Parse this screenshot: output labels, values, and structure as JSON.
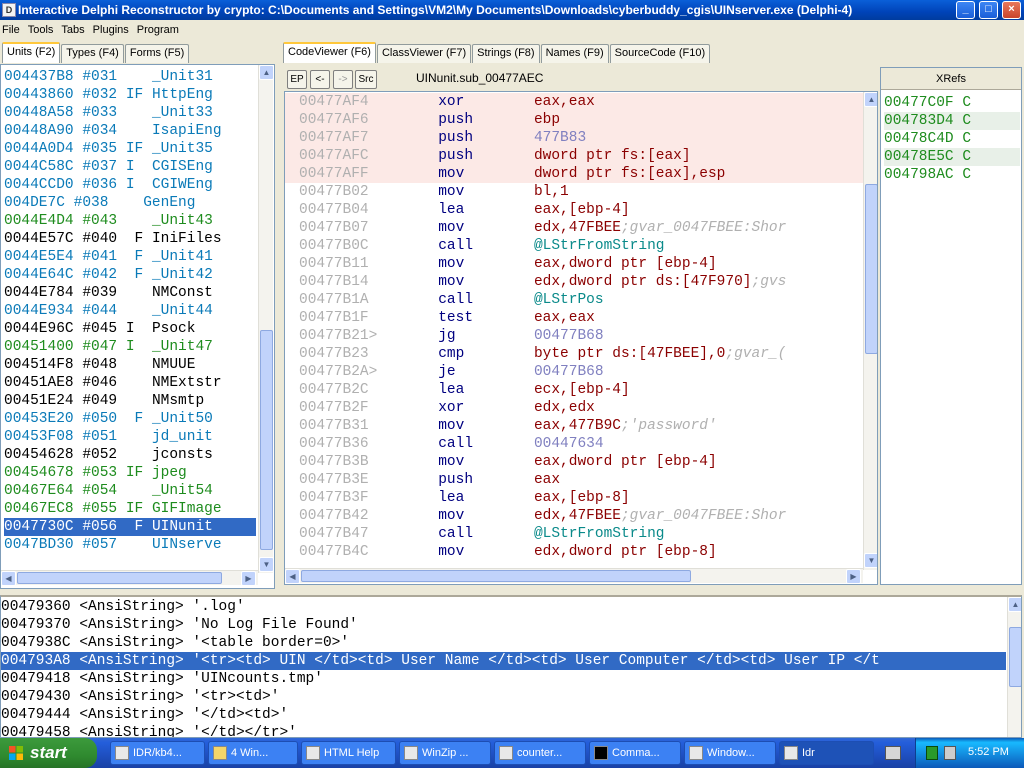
{
  "window": {
    "title": "Interactive Delphi Reconstructor by crypto: C:\\Documents and Settings\\VM2\\My Documents\\Downloads\\cyberbuddy_cgis\\UINserver.exe (Delphi-4)",
    "minimize": "_",
    "maximize": "□",
    "close": "×"
  },
  "menu": [
    "File",
    "Tools",
    "Tabs",
    "Plugins",
    "Program"
  ],
  "left_tabs": [
    "Units (F2)",
    "Types (F4)",
    "Forms (F5)"
  ],
  "units": [
    {
      "addr": "004437B8",
      "num": "#031",
      "flags": "  ",
      "name": "_Unit31",
      "color": "#0a7ab8"
    },
    {
      "addr": "00443860",
      "num": "#032",
      "flags": "IF",
      "name": "HttpEng",
      "color": "#0a7ab8"
    },
    {
      "addr": "00448A58",
      "num": "#033",
      "flags": "  ",
      "name": "_Unit33",
      "color": "#0a7ab8"
    },
    {
      "addr": "00448A90",
      "num": "#034",
      "flags": "  ",
      "name": "IsapiEng",
      "color": "#0a7ab8"
    },
    {
      "addr": "0044A0D4",
      "num": "#035",
      "flags": "IF",
      "name": "_Unit35",
      "color": "#0a7ab8"
    },
    {
      "addr": "0044C58C",
      "num": "#037",
      "flags": "I ",
      "name": "CGISEng",
      "color": "#0a7ab8"
    },
    {
      "addr": "0044CCD0",
      "num": "#036",
      "flags": "I ",
      "name": "CGIWEng",
      "color": "#0a7ab8"
    },
    {
      "addr": "004DE7C",
      "num": "#038",
      "flags": "  ",
      "name": "GenEng",
      "color": "#0a7ab8"
    },
    {
      "addr": "0044E4D4",
      "num": "#043",
      "flags": "  ",
      "name": "_Unit43",
      "color": "#1e8c1e"
    },
    {
      "addr": "0044E57C",
      "num": "#040",
      "flags": " F",
      "name": "IniFiles",
      "color": "#000000"
    },
    {
      "addr": "0044E5E4",
      "num": "#041",
      "flags": " F",
      "name": "_Unit41",
      "color": "#0a7ab8"
    },
    {
      "addr": "0044E64C",
      "num": "#042",
      "flags": " F",
      "name": "_Unit42",
      "color": "#0a7ab8"
    },
    {
      "addr": "0044E784",
      "num": "#039",
      "flags": "  ",
      "name": "NMConst",
      "color": "#000000"
    },
    {
      "addr": "0044E934",
      "num": "#044",
      "flags": "  ",
      "name": "_Unit44",
      "color": "#0a7ab8"
    },
    {
      "addr": "0044E96C",
      "num": "#045",
      "flags": "I ",
      "name": "Psock",
      "color": "#000000"
    },
    {
      "addr": "00451400",
      "num": "#047",
      "flags": "I ",
      "name": "_Unit47",
      "color": "#1e8c1e"
    },
    {
      "addr": "004514F8",
      "num": "#048",
      "flags": "  ",
      "name": "NMUUE",
      "color": "#000000"
    },
    {
      "addr": "00451AE8",
      "num": "#046",
      "flags": "  ",
      "name": "NMExtstr",
      "color": "#000000"
    },
    {
      "addr": "00451E24",
      "num": "#049",
      "flags": "  ",
      "name": "NMsmtp",
      "color": "#000000"
    },
    {
      "addr": "00453E20",
      "num": "#050",
      "flags": " F",
      "name": "_Unit50",
      "color": "#0a7ab8"
    },
    {
      "addr": "00453F08",
      "num": "#051",
      "flags": "  ",
      "name": "jd_unit",
      "color": "#0a7ab8"
    },
    {
      "addr": "00454628",
      "num": "#052",
      "flags": "  ",
      "name": "jconsts",
      "color": "#000000"
    },
    {
      "addr": "00454678",
      "num": "#053",
      "flags": "IF",
      "name": "jpeg",
      "color": "#1e8c1e"
    },
    {
      "addr": "00467E64",
      "num": "#054",
      "flags": "  ",
      "name": "_Unit54",
      "color": "#1e8c1e"
    },
    {
      "addr": "00467EC8",
      "num": "#055",
      "flags": "IF",
      "name": "GIFImage",
      "color": "#1e8c1e"
    },
    {
      "addr": "0047730C",
      "num": "#056",
      "flags": " F",
      "name": "UINunit",
      "color": "#ffffff",
      "selected": true
    },
    {
      "addr": "0047BD30",
      "num": "#057",
      "flags": "  ",
      "name": "UINserve",
      "color": "#0a7ab8"
    }
  ],
  "code_tabs": [
    "CodeViewer (F6)",
    "ClassViewer (F7)",
    "Strings (F8)",
    "Names (F9)",
    "SourceCode (F10)"
  ],
  "toolbar": {
    "ep": "EP",
    "back": "<-",
    "fwd": "->",
    "src": "Src",
    "proc_name": "UINunit.sub_00477AEC"
  },
  "code": [
    {
      "addr": "00477AF4",
      "mn": "xor",
      "op": "eax,eax",
      "cm": "",
      "hl": true
    },
    {
      "addr": "00477AF6",
      "mn": "push",
      "op": "ebp",
      "cm": "",
      "hl": true
    },
    {
      "addr": "00477AF7",
      "mn": "push",
      "op": "477B83",
      "cm": "",
      "hl": true,
      "opc": "#8080c0"
    },
    {
      "addr": "00477AFC",
      "mn": "push",
      "op": "dword ptr fs:[eax]",
      "cm": "",
      "hl": true
    },
    {
      "addr": "00477AFF",
      "mn": "mov",
      "op": "dword ptr fs:[eax],esp",
      "cm": "",
      "hl": true
    },
    {
      "addr": "00477B02",
      "mn": "mov",
      "op": "bl,1",
      "cm": ""
    },
    {
      "addr": "00477B04",
      "mn": "lea",
      "op": "eax,[ebp-4]",
      "cm": ""
    },
    {
      "addr": "00477B07",
      "mn": "mov",
      "op": "edx,47FBEE",
      "cm": ";gvar_0047FBEE:Shor"
    },
    {
      "addr": "00477B0C",
      "mn": "call",
      "op": "@LStrFromString",
      "cm": "",
      "opc": "#0a8a8a"
    },
    {
      "addr": "00477B11",
      "mn": "mov",
      "op": "eax,dword ptr [ebp-4]",
      "cm": ""
    },
    {
      "addr": "00477B14",
      "mn": "mov",
      "op": "edx,dword ptr ds:[47F970]",
      "cm": ";gvs"
    },
    {
      "addr": "00477B1A",
      "mn": "call",
      "op": "@LStrPos",
      "cm": "",
      "opc": "#0a8a8a"
    },
    {
      "addr": "00477B1F",
      "mn": "test",
      "op": "eax,eax",
      "cm": ""
    },
    {
      "addr": "00477B21>",
      "mn": "jg",
      "op": "00477B68",
      "cm": "",
      "opc": "#8080c0"
    },
    {
      "addr": "00477B23",
      "mn": "cmp",
      "op": "byte ptr ds:[47FBEE],0",
      "cm": ";gvar_("
    },
    {
      "addr": "00477B2A>",
      "mn": "je",
      "op": "00477B68",
      "cm": "",
      "opc": "#8080c0"
    },
    {
      "addr": "00477B2C",
      "mn": "lea",
      "op": "ecx,[ebp-4]",
      "cm": ""
    },
    {
      "addr": "00477B2F",
      "mn": "xor",
      "op": "edx,edx",
      "cm": ""
    },
    {
      "addr": "00477B31",
      "mn": "mov",
      "op": "eax,477B9C",
      "cm": ";'password'"
    },
    {
      "addr": "00477B36",
      "mn": "call",
      "op": "00447634",
      "cm": "",
      "opc": "#8080c0"
    },
    {
      "addr": "00477B3B",
      "mn": "mov",
      "op": "eax,dword ptr [ebp-4]",
      "cm": ""
    },
    {
      "addr": "00477B3E",
      "mn": "push",
      "op": "eax",
      "cm": ""
    },
    {
      "addr": "00477B3F",
      "mn": "lea",
      "op": "eax,[ebp-8]",
      "cm": ""
    },
    {
      "addr": "00477B42",
      "mn": "mov",
      "op": "edx,47FBEE",
      "cm": ";gvar_0047FBEE:Shor"
    },
    {
      "addr": "00477B47",
      "mn": "call",
      "op": "@LStrFromString",
      "cm": "",
      "opc": "#0a8a8a"
    },
    {
      "addr": "00477B4C",
      "mn": "mov",
      "op": "edx,dword ptr [ebp-8]",
      "cm": ""
    }
  ],
  "xrefs_header": "XRefs",
  "xrefs": [
    {
      "addr": "00477C0F",
      "t": "C",
      "sel": false
    },
    {
      "addr": "004783D4",
      "t": "C",
      "sel": true
    },
    {
      "addr": "00478C4D",
      "t": "C",
      "sel": false
    },
    {
      "addr": "00478E5C",
      "t": "C",
      "sel": true
    },
    {
      "addr": "004798AC",
      "t": "C",
      "sel": false
    }
  ],
  "strings": [
    {
      "addr": "00479360",
      "type": "<AnsiString>",
      "val": "'.log'"
    },
    {
      "addr": "00479370",
      "type": "<AnsiString>",
      "val": "'No Log File Found'"
    },
    {
      "addr": "0047938C",
      "type": "<AnsiString>",
      "val": "'<table border=0>'"
    },
    {
      "addr": "004793A8",
      "type": "<AnsiString>",
      "val": "'<tr><td> UIN </td><td> User Name </td><td> User Computer </td><td> User IP </t",
      "sel": true
    },
    {
      "addr": "00479418",
      "type": "<AnsiString>",
      "val": "'UINcounts.tmp'"
    },
    {
      "addr": "00479430",
      "type": "<AnsiString>",
      "val": "'<tr><td>'"
    },
    {
      "addr": "00479444",
      "type": "<AnsiString>",
      "val": "'</td><td>'"
    },
    {
      "addr": "00479458",
      "type": "<AnsiString>",
      "val": "'</td></tr>'"
    }
  ],
  "taskbar": {
    "start": "start",
    "tasks": [
      "IDR/kb4...",
      "4 Win...",
      "HTML Help",
      "WinZip ...",
      "counter...",
      "Comma...",
      "Window...",
      "Idr"
    ],
    "clock": "5:52 PM"
  }
}
